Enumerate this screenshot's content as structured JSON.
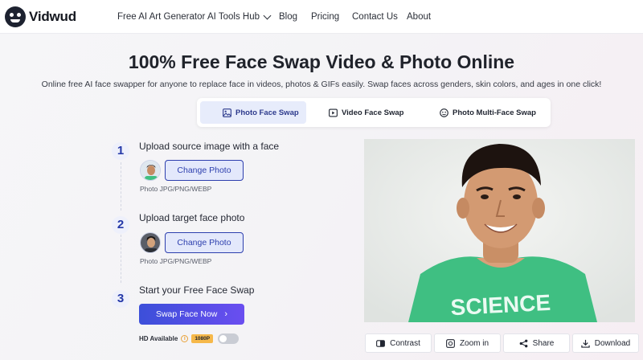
{
  "brand": {
    "name": "Vidwud"
  },
  "nav": {
    "items": [
      {
        "label": "Free AI Art Generator"
      },
      {
        "label": "AI Tools Hub",
        "has_dropdown": true
      },
      {
        "label": "Blog"
      },
      {
        "label": "Pricing"
      },
      {
        "label": "Contact Us"
      },
      {
        "label": "About"
      }
    ]
  },
  "hero": {
    "title": "100% Free Face Swap Video & Photo Online",
    "subtitle": "Online free AI face swapper for anyone to replace face in videos, photos & GIFs easily. Swap faces across genders, skin colors, and ages in one click!"
  },
  "tabs": [
    {
      "label": "Photo Face Swap",
      "icon": "image-icon",
      "active": true
    },
    {
      "label": "Video Face Swap",
      "icon": "video-icon",
      "active": false
    },
    {
      "label": "Photo Multi-Face Swap",
      "icon": "multi-face-icon",
      "active": false
    }
  ],
  "steps": [
    {
      "number": "1",
      "title": "Upload source image with a face",
      "button": "Change Photo",
      "hint": "Photo JPG/PNG/WEBP"
    },
    {
      "number": "2",
      "title": "Upload target face photo",
      "button": "Change Photo",
      "hint": "Photo JPG/PNG/WEBP"
    },
    {
      "number": "3",
      "title": "Start your Free Face Swap",
      "button": "Swap Face Now",
      "button_arrow": "›"
    }
  ],
  "hd": {
    "label": "HD Available",
    "badge": "1080P",
    "enabled": false
  },
  "preview": {
    "shirt_text": "SCIENCE"
  },
  "actions": [
    {
      "label": "Contrast",
      "icon": "contrast-icon"
    },
    {
      "label": "Zoom in",
      "icon": "zoom-in-icon"
    },
    {
      "label": "Share",
      "icon": "share-icon"
    },
    {
      "label": "Download",
      "icon": "download-icon"
    }
  ],
  "colors": {
    "accent": "#2d3fae",
    "primary_gradient_start": "#3c4fd9",
    "primary_gradient_end": "#6a4ef0",
    "badge": "#f6b84a",
    "shirt": "#3fbf82"
  }
}
